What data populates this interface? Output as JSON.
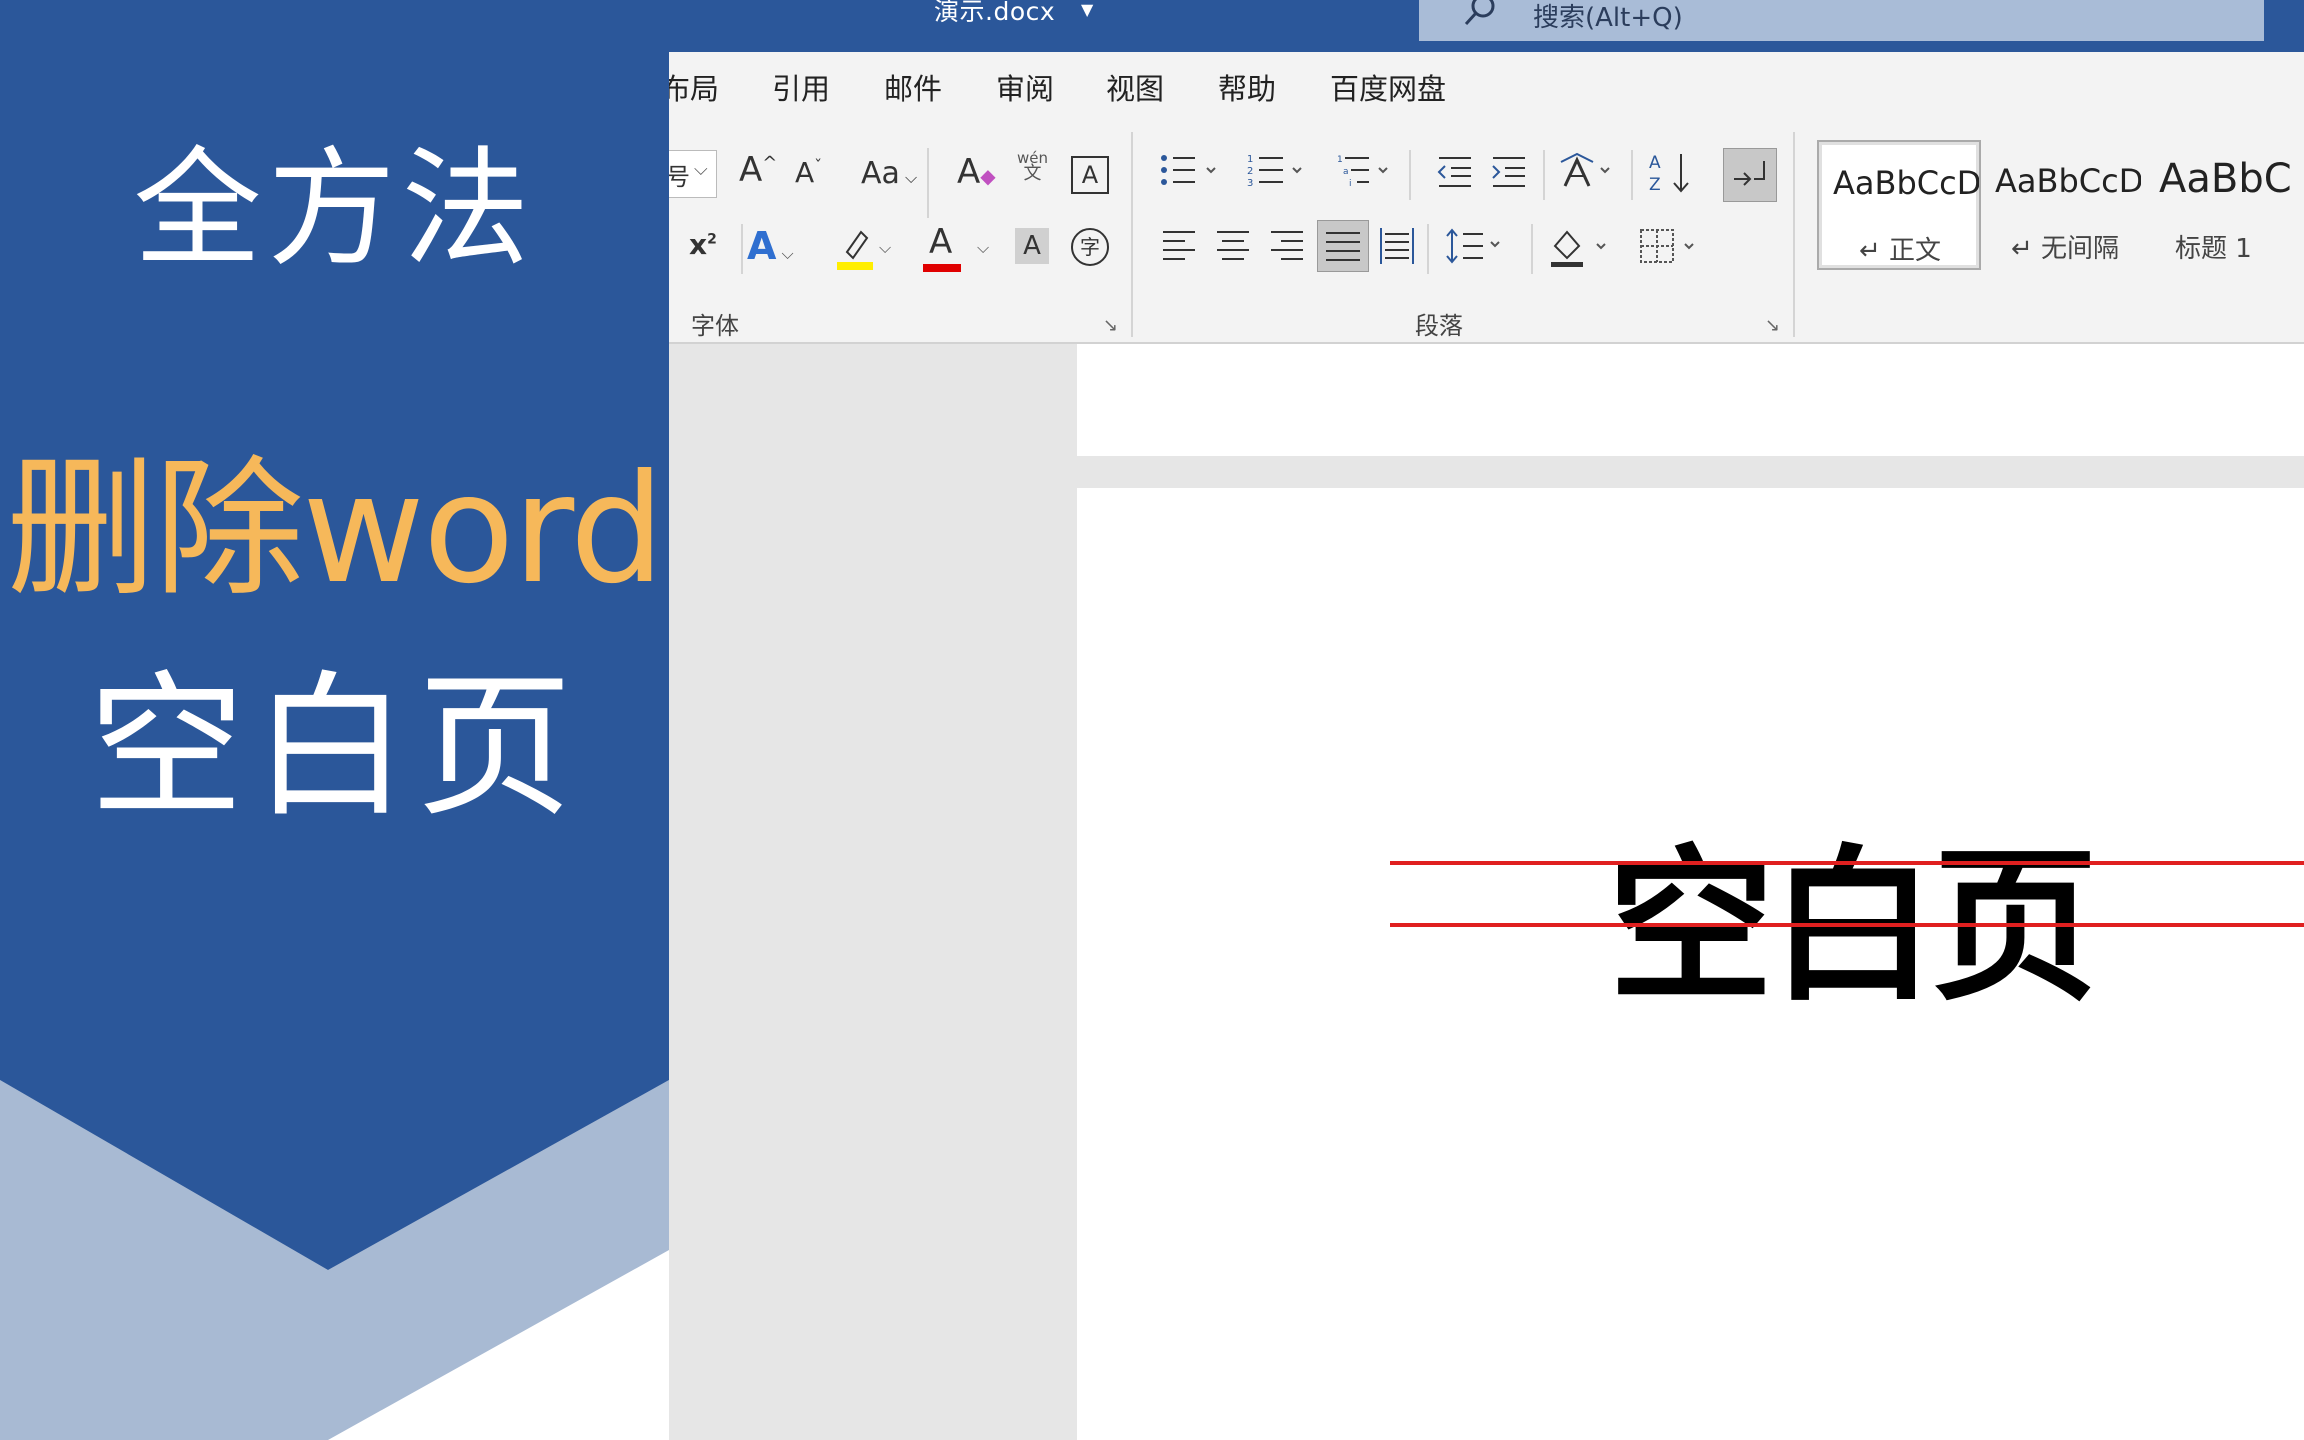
{
  "banner": {
    "line1": "全方法",
    "line2": "删除word",
    "line3": "空白页",
    "colors": {
      "primary": "#2b579a",
      "light": "#a8bad3",
      "accent": "#f6b85a"
    }
  },
  "titlebar": {
    "doc_title": "演示.docx",
    "search_placeholder": "搜索(Alt+Q)"
  },
  "menu": {
    "items": [
      "布局",
      "引用",
      "邮件",
      "审阅",
      "视图",
      "帮助",
      "百度网盘"
    ]
  },
  "ribbon": {
    "font_group_label": "字体",
    "paragraph_group_label": "段落",
    "font_size_fragment": "号",
    "grow_font": "A",
    "shrink_font": "A",
    "change_case": "Aa",
    "phonetic_top": "wén",
    "phonetic_bottom": "文",
    "char_border": "A",
    "superscript": "x",
    "superscript_mark": "2",
    "text_effects": "A",
    "font_color": "A",
    "char_shading": "A",
    "enclose_char": "字",
    "sort": "A↓",
    "styles": [
      {
        "sample": "AaBbCcDd",
        "name": "↵ 正文"
      },
      {
        "sample": "AaBbCcDd",
        "name": "↵ 无间隔"
      },
      {
        "sample": "AaBbC",
        "name": "标题 1"
      }
    ]
  },
  "document": {
    "body_text": "空白页"
  }
}
